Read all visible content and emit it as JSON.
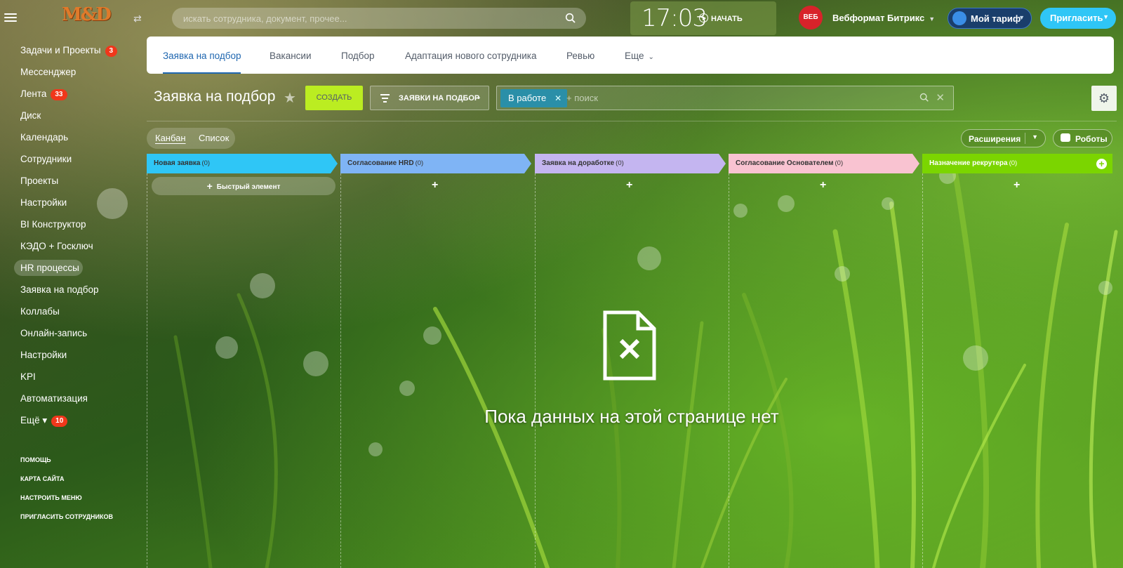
{
  "header": {
    "logo_text": "M&D",
    "search_placeholder": "искать сотрудника, документ, прочее...",
    "clock_time": "17:03",
    "clock_start": "НАЧАТЬ",
    "company_logo_text": "ВЕБ",
    "company_name": "Вебформат Битрикс",
    "tariff_label": "Мой тариф",
    "invite_label": "Пригласить"
  },
  "sidebar": {
    "items": [
      {
        "label": "Задачи и Проекты",
        "badge": "3"
      },
      {
        "label": "Мессенджер",
        "badge": ""
      },
      {
        "label": "Лента",
        "badge": "33"
      },
      {
        "label": "Диск",
        "badge": ""
      },
      {
        "label": "Календарь",
        "badge": ""
      },
      {
        "label": "Сотрудники",
        "badge": ""
      },
      {
        "label": "Проекты",
        "badge": ""
      },
      {
        "label": "Настройки",
        "badge": ""
      },
      {
        "label": "BI Конструктор",
        "badge": ""
      },
      {
        "label": "КЭДО + Госключ",
        "badge": ""
      },
      {
        "label": "HR процессы",
        "badge": ""
      },
      {
        "label": "Заявка на подбор",
        "badge": ""
      },
      {
        "label": "Коллабы",
        "badge": ""
      },
      {
        "label": "Онлайн-запись",
        "badge": ""
      },
      {
        "label": "Настройки",
        "badge": ""
      },
      {
        "label": "KPI",
        "badge": ""
      },
      {
        "label": "Автоматизация",
        "badge": ""
      },
      {
        "label": "Ещё",
        "badge": "10"
      }
    ],
    "footer": [
      "ПОМОЩЬ",
      "КАРТА САЙТА",
      "НАСТРОИТЬ МЕНЮ",
      "ПРИГЛАСИТЬ СОТРУДНИКОВ"
    ]
  },
  "tabs": [
    "Заявка на подбор",
    "Вакансии",
    "Подбор",
    "Адаптация нового сотрудника",
    "Ревью",
    "Еще"
  ],
  "toolbar": {
    "title": "Заявка на подбор",
    "create_label": "СОЗДАТЬ",
    "filter_label": "ЗАЯВКИ НА ПОДБОР",
    "chip_label": "В работе",
    "search_placeholder": "+ поиск"
  },
  "view": {
    "kanban": "Канбан",
    "list": "Список",
    "extensions": "Расширения",
    "robots": "Роботы"
  },
  "kanban": {
    "quick_add": "Быстрый элемент",
    "stages": [
      {
        "name": "Новая заявка",
        "count": "(0)",
        "color": "#2fc6f6"
      },
      {
        "name": "Согласование HRD",
        "count": "(0)",
        "color": "#7fb4f5"
      },
      {
        "name": "Заявка на доработке",
        "count": "(0)",
        "color": "#c4b5f0"
      },
      {
        "name": "Согласование Основателем",
        "count": "(0)",
        "color": "#f9c3d1"
      },
      {
        "name": "Назначение рекрутера",
        "count": "(0)",
        "color": "#7bd500"
      }
    ],
    "empty_text": "Пока данных на этой странице нет"
  }
}
